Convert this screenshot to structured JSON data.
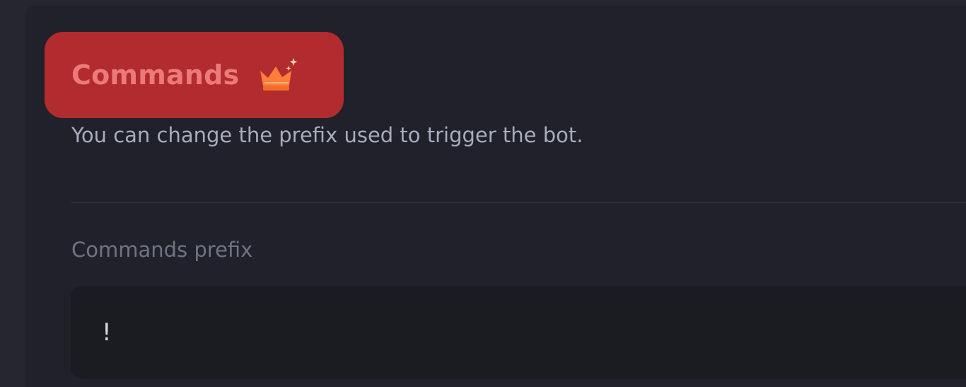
{
  "section": {
    "title": "Commands",
    "title_icon": "crown-sparkle-icon",
    "description": "You can change the prefix used to trigger the bot."
  },
  "prefix_field": {
    "label": "Commands prefix",
    "value": "!"
  },
  "colors": {
    "background": "#25262f",
    "card": "#20212a",
    "title_chip": "#b22b2e",
    "title_text": "#ec7a78",
    "crown": "#ff7d3a",
    "input_background": "#1b1c21"
  }
}
